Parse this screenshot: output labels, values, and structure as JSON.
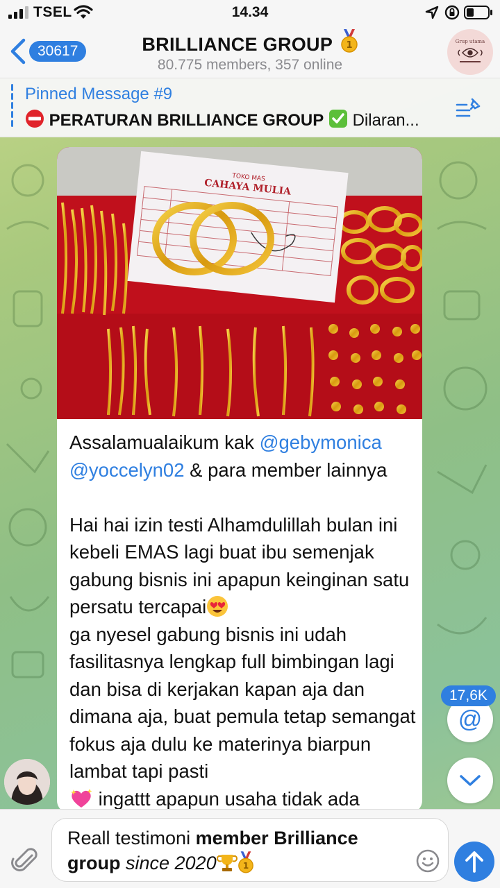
{
  "status_bar": {
    "carrier": "TSEL",
    "time": "14.34"
  },
  "header": {
    "back_count": "30617",
    "title": "BRILLIANCE GROUP",
    "subtitle": "80.775 members, 357 online",
    "avatar_text": "Grup utama"
  },
  "pinned": {
    "title": "Pinned Message #9",
    "text_bold": "PERATURAN BRILLIANCE GROUP",
    "text_rest": "Dilaran..."
  },
  "photo": {
    "receipt_shop": "TOKO MAS",
    "receipt_name": "CAHAYA MULIA"
  },
  "message": {
    "line1_start": "Assalamualaikum kak ",
    "mention1": "@gebymonica",
    "mention2": "@yoccelyn02",
    "line2_rest": " & para member lainnya",
    "para2_a": "Hai hai izin testi Alhamdulillah bulan ini kebeli EMAS lagi buat ibu semenjak gabung bisnis ini apapun keinginan satu persatu tercapai",
    "para2_b": "ga nyesel gabung bisnis ini udah fasilitasnya lengkap full bimbingan lagi dan bisa di kerjakan kapan aja dan dimana aja, buat pemula tetap semangat fokus aja dulu ke materinya biarpun lambat tapi pasti",
    "para2_c": " ingattt apapun usaha tidak ada"
  },
  "floating": {
    "mention_count": "17,6K",
    "mention_symbol": "@"
  },
  "input": {
    "text_a": "Reall testimoni ",
    "text_b": "member Brilliance group",
    "text_c": " since 2020"
  },
  "colors": {
    "accent": "#2f7fe0",
    "bar_bg": "#f6f6f6",
    "photo_red": "#b8121c"
  }
}
